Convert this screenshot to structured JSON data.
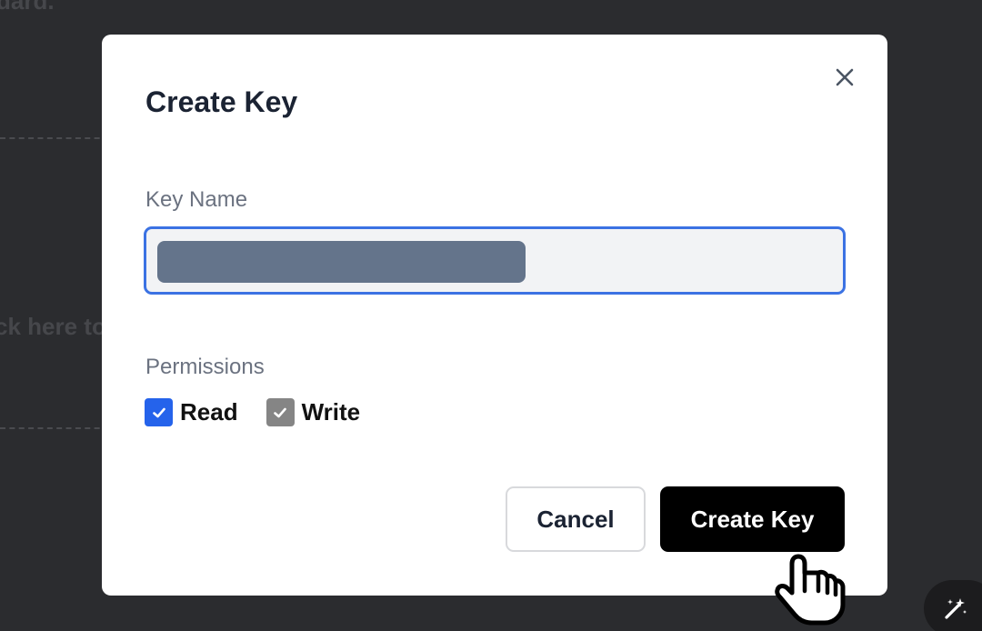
{
  "background": {
    "partial_text_top": "dard.",
    "partial_text_mid": "ck here to"
  },
  "modal": {
    "title": "Create Key",
    "close_icon": "close-icon",
    "key_name": {
      "label": "Key Name",
      "value_redacted": true
    },
    "permissions": {
      "label": "Permissions",
      "items": [
        {
          "label": "Read",
          "checked": true,
          "color": "#2563eb"
        },
        {
          "label": "Write",
          "checked": true,
          "color": "#858585"
        }
      ]
    },
    "buttons": {
      "cancel_label": "Cancel",
      "create_label": "Create Key"
    }
  },
  "colors": {
    "accent": "#2563eb",
    "input_border": "#3b72e3",
    "primary_button": "#000000",
    "backdrop": "#2b2c2f"
  },
  "floating_action": {
    "icon": "magic-wand-icon"
  }
}
